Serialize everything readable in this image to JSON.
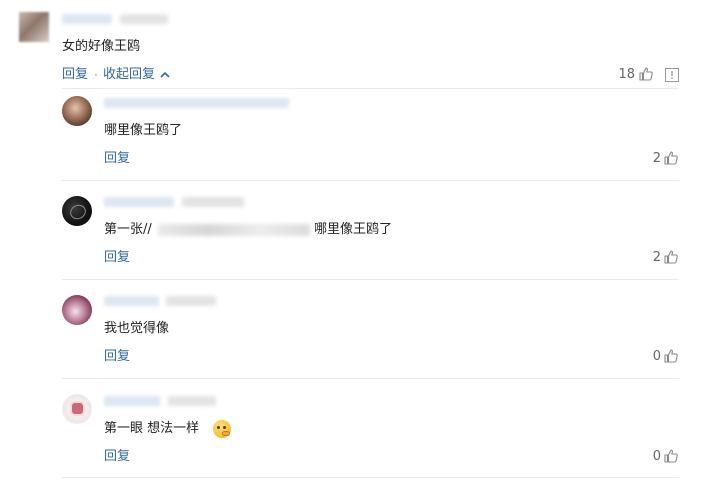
{
  "main_comment": {
    "text": "女的好像王鸥",
    "reply_label": "回复",
    "separator": "·",
    "collapse_label": "收起回复",
    "collapse_icon": "chevron-up-icon",
    "like_count": "18",
    "report_icon": "report-icon"
  },
  "replies": [
    {
      "text": "哪里像王鸥了",
      "reply_label": "回复",
      "like_count": "2"
    },
    {
      "text_prefix": "第一张//",
      "text_suffix": "哪里像王鸥了",
      "reply_label": "回复",
      "like_count": "2"
    },
    {
      "text": "我也觉得像",
      "reply_label": "回复",
      "like_count": "0"
    },
    {
      "text": "第一眼 想法一样",
      "emoji_icon": "thinking-face-emoji",
      "reply_label": "回复",
      "like_count": "0"
    }
  ],
  "colors": {
    "link": "#33689c",
    "text": "#222222",
    "count": "#666666",
    "divider": "#eaeaea"
  }
}
